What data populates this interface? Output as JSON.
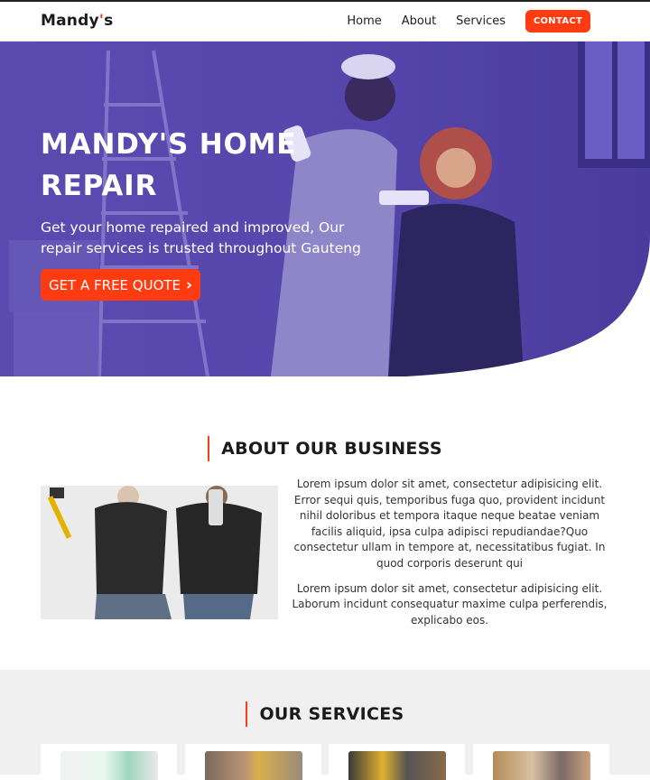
{
  "nav": {
    "brand_main": "Mandy",
    "brand_accent": "'",
    "brand_tail": "s",
    "links": [
      {
        "label": "Home"
      },
      {
        "label": "About"
      },
      {
        "label": "Services"
      }
    ],
    "contact_label": "CONTACT"
  },
  "hero": {
    "title": "MANDY'S HOME REPAIR",
    "subtitle": "Get your home repaired and improved, Our repair services is trusted throughout Gauteng",
    "cta_label": "GET A FREE QUOTE",
    "cta_icon": "chevron-right-icon"
  },
  "about": {
    "title": "ABOUT OUR BUSINESS",
    "paragraph_1": "Lorem ipsum dolor sit amet, consectetur adipisicing elit. Error sequi quis, temporibus fuga quo, provident incidunt nihil doloribus et tempora itaque neque beatae veniam facilis aliquid, ipsa culpa adipisci repudiandae?Quo consectetur ullam in tempore at, necessitatibus fugiat. In quod corporis deserunt qui",
    "paragraph_2": "Lorem ipsum dolor sit amet, consectetur adipisicing elit. Laborum incidunt consequatur maxime culpa perferendis, explicabo eos."
  },
  "services": {
    "title": "OUR SERVICES"
  },
  "colors": {
    "accent": "#ff3b12",
    "hero_overlay": "#4b3aa6",
    "services_bg": "#f0f0f0"
  }
}
